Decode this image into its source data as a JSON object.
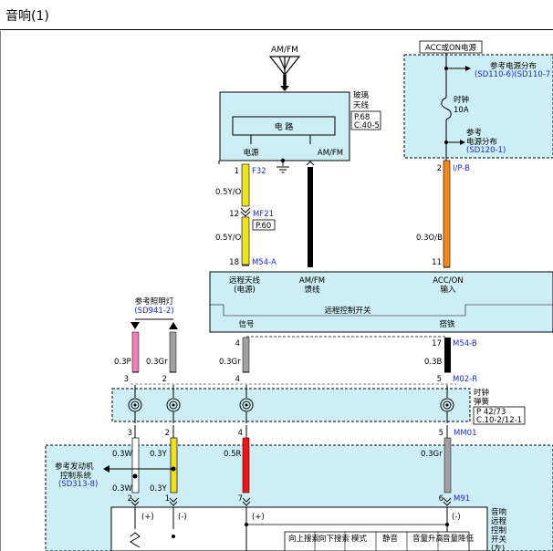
{
  "title": "音响(1)",
  "antenna": {
    "label": "AM/FM"
  },
  "glass_antenna": {
    "name_line1": "玻璃",
    "name_line2": "天线",
    "circuit": "电 路",
    "pin_power": "电源",
    "pin_amfm": "AM/FM",
    "ref_page": "P.68",
    "ref_conn": "C.40-5"
  },
  "acc_supply": {
    "label": "ACC或ON电源",
    "ref_dist_label": "参考电源分布",
    "ref_dist_codes": "(SD110-6)(SD110-7",
    "fuse_name": "时钟",
    "fuse_rating": "10A",
    "ref2_line1": "参考",
    "ref2_line2": "电源分布",
    "ref2_code": "(SD120-1)"
  },
  "wires": {
    "w1_pin": "1",
    "w1_conn": "F32",
    "w1_spec": "0.5Y/O",
    "w12_pin": "12",
    "w12_conn": "MF21",
    "w12_page": "P.60",
    "w18_spec": "0.5Y/O",
    "w18_pin": "18",
    "w18_conn": "M54-A",
    "acc_pin": "2",
    "acc_conn": "I/P-B",
    "acc_spec": "0.3O/B",
    "acc_pin2": "11"
  },
  "remote_switch": {
    "col1_line1": "远程天线",
    "col1_line2": "(电源)",
    "col2_line1": "AM/FM",
    "col2_line2": "馈线",
    "col3_line1": "ACC/ON",
    "col3_line2": "输入",
    "name": "远程控制开关",
    "signal": "信号",
    "ground": "搭铁"
  },
  "lamp_ref": {
    "line1": "参考照明灯",
    "code": "(SD941-2)"
  },
  "lower_wires": {
    "p_spec": "0.3P",
    "p_pin": "3",
    "gr_spec": "0.3Gr",
    "gr_pin": "2",
    "sig_pin_top": "4",
    "sig_spec": "0.3Gr",
    "sig_pin": "4",
    "gnd_pin_top": "17",
    "gnd_conn_top": "M54-B",
    "gnd_spec": "0.3B",
    "gnd_pin": "5",
    "gnd_conn": "M02-R"
  },
  "clock_spring": {
    "name_line1": "时钟",
    "name_line2": "弹簧",
    "ref_page": "P 42/73",
    "ref_conn": "C.10-2/12-1"
  },
  "bottom_wires": {
    "w_pin": "3",
    "y_pin": "2",
    "r_pin": "4",
    "gr_pin": "5",
    "gr_conn": "MM01",
    "w_spec": "0.3W",
    "y_spec": "0.3Y",
    "r_spec": "0.5R",
    "gr_spec": "0.3Gr",
    "w_spec2": "0.3W",
    "y_spec2": "0.3Y",
    "w_pin2": "2",
    "y_pin2": "1",
    "r_pin2": "7",
    "gr_pin2": "6",
    "gr_conn2": "M91"
  },
  "engine_ref": {
    "line1": "参考发动机",
    "line2": "控制系统",
    "code": "(SD313-8)"
  },
  "steering_switch": {
    "name_lines": [
      "音响",
      "远程",
      "控制",
      "开关",
      "(左)"
    ],
    "plus": "(+)",
    "minus": "(-)",
    "plus2": "(+)",
    "minus2": "(-)",
    "buttons": [
      "向上搜索",
      "向下搜索",
      "模式",
      "静音",
      "音量升高",
      "音量降低"
    ]
  },
  "colors": {
    "panel_fill": "#cdeef4",
    "wire_yellow": "#f0e020",
    "wire_orange": "#f08a1e",
    "wire_gray": "#a0a0a0",
    "wire_pink": "#f080b8",
    "wire_red": "#e81818",
    "wire_black": "#000000",
    "label_blue": "#1a2bcc"
  }
}
